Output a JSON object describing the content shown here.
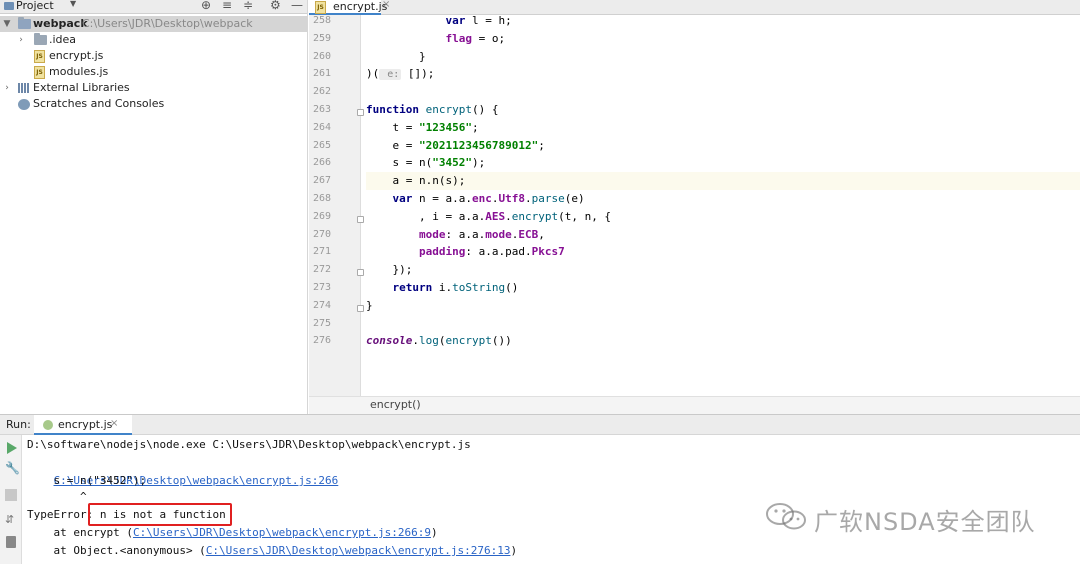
{
  "project_panel": {
    "title": "Project",
    "tree": [
      {
        "label": "webpack",
        "path": "C:\\Users\\JDR\\Desktop\\webpack",
        "type": "folder",
        "expanded": true,
        "selected": true
      },
      {
        "label": ".idea",
        "type": "folder",
        "expanded": false
      },
      {
        "label": "encrypt.js",
        "type": "js-file"
      },
      {
        "label": "modules.js",
        "type": "js-file"
      },
      {
        "label": "External Libraries",
        "type": "library"
      },
      {
        "label": "Scratches and Consoles",
        "type": "scratches"
      }
    ]
  },
  "editor": {
    "tab_label": "encrypt.js",
    "lines": [
      {
        "no": "258",
        "text": "            var l = h;"
      },
      {
        "no": "259",
        "text": "            flag = o;"
      },
      {
        "no": "260",
        "text": "        }"
      },
      {
        "no": "261",
        "text": ")( e: []);"
      },
      {
        "no": "262",
        "text": ""
      },
      {
        "no": "263",
        "text": "function encrypt() {"
      },
      {
        "no": "264",
        "text": "    t = \"123456\";"
      },
      {
        "no": "265",
        "text": "    e = \"2021123456789012\";"
      },
      {
        "no": "266",
        "text": "    s = n(\"3452\");"
      },
      {
        "no": "267",
        "text": "    a = n.n(s);"
      },
      {
        "no": "268",
        "text": "    var n = a.a.enc.Utf8.parse(e)"
      },
      {
        "no": "269",
        "text": "        , i = a.a.AES.encrypt(t, n, {"
      },
      {
        "no": "270",
        "text": "        mode: a.a.mode.ECB,"
      },
      {
        "no": "271",
        "text": "        padding: a.a.pad.Pkcs7"
      },
      {
        "no": "272",
        "text": "    });"
      },
      {
        "no": "273",
        "text": "    return i.toString()"
      },
      {
        "no": "274",
        "text": "}"
      },
      {
        "no": "275",
        "text": ""
      },
      {
        "no": "276",
        "text": "console.log(encrypt())"
      }
    ],
    "current_line": "267",
    "breadcrumb": "encrypt()"
  },
  "run_panel": {
    "label": "Run:",
    "tab_label": "encrypt.js",
    "console": {
      "line1": "D:\\software\\nodejs\\node.exe C:\\Users\\JDR\\Desktop\\webpack\\encrypt.js",
      "line2_link": "C:\\Users\\JDR\\Desktop\\webpack\\encrypt.js:266",
      "line3": "    s = n(\"3452\");",
      "line4": "        ^",
      "line5_prefix": "TypeError: ",
      "line5_msg": "n is not a function",
      "line6_prefix": "    at encrypt (",
      "line6_link": "C:\\Users\\JDR\\Desktop\\webpack\\encrypt.js:266:9",
      "line6_suffix": ")",
      "line7_prefix": "    at Object.<anonymous> (",
      "line7_link": "C:\\Users\\JDR\\Desktop\\webpack\\encrypt.js:276:13",
      "line7_suffix": ")"
    }
  },
  "watermark": {
    "text": "广软NSDA安全团队",
    "icon": "wechat-icon"
  },
  "colors": {
    "keyword": "#000080",
    "string": "#008000",
    "link": "#2a64c6",
    "highlight_box": "#e02020",
    "selection": "#d5d5d5"
  }
}
